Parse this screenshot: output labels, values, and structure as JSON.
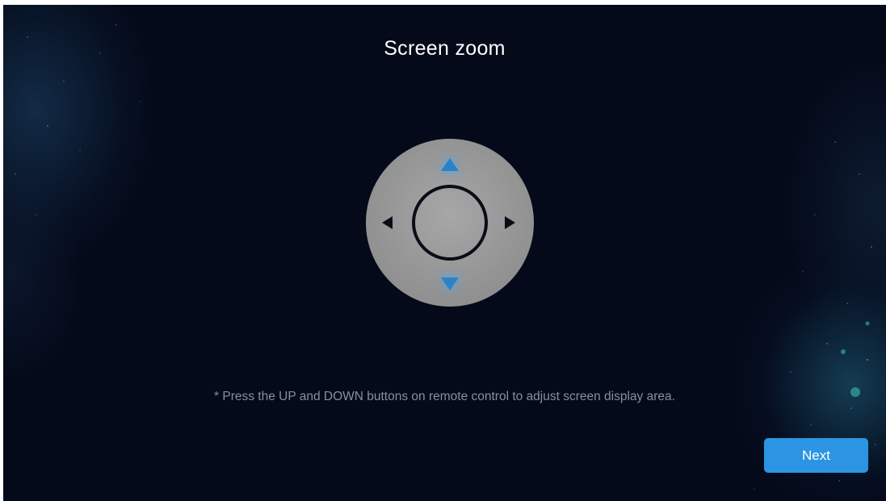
{
  "page": {
    "title": "Screen zoom",
    "hint": "* Press the UP and DOWN buttons on remote control to adjust screen display area."
  },
  "remote": {
    "icons": [
      "arrow-up-icon",
      "arrow-down-icon",
      "arrow-left-icon",
      "arrow-right-icon",
      "ok-ring-icon"
    ],
    "highlighted": [
      "up",
      "down"
    ]
  },
  "actions": {
    "next_label": "Next"
  },
  "colors": {
    "background": "#040a1a",
    "accent": "#2b95e3",
    "highlight_arrow": "#2a82c8",
    "remote_body": "#959595",
    "hint_text": "#8a8f98"
  }
}
